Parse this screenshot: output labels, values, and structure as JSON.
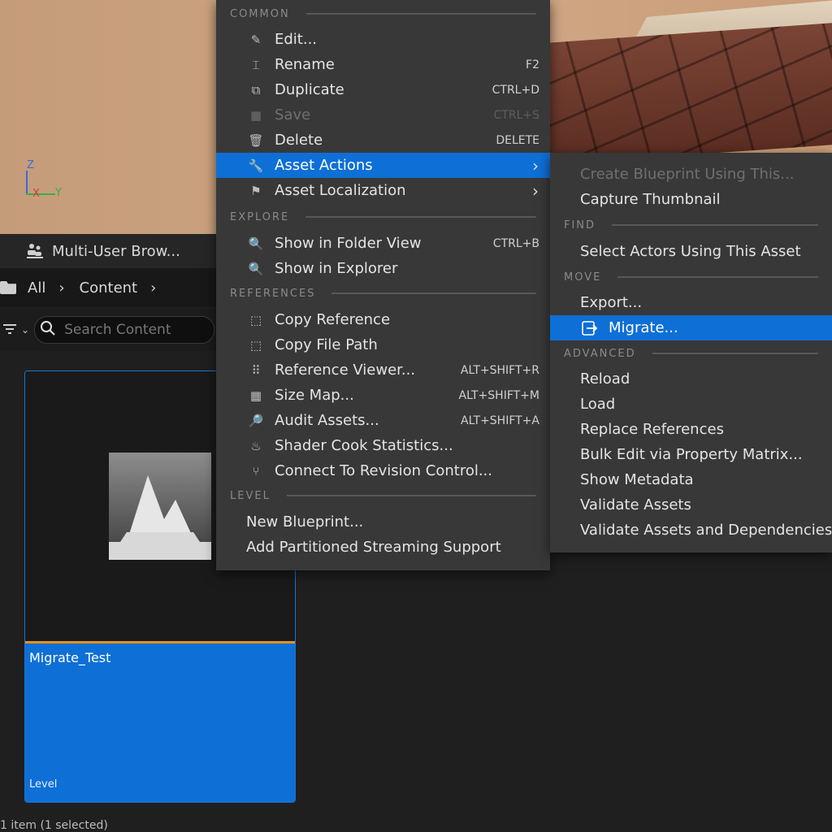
{
  "viewport": {
    "axes": {
      "z": "Z",
      "x": "X",
      "y": "Y"
    }
  },
  "multi_user": {
    "label": "Multi-User Brow..."
  },
  "path": {
    "root": "All",
    "folder": "Content"
  },
  "search": {
    "placeholder": "Search Content"
  },
  "asset": {
    "name": "Migrate_Test",
    "type": "Level"
  },
  "status_text": "1 item (1 selected)",
  "colors": {
    "highlight": "#0e6fd6",
    "menu_bg": "#383838",
    "thumb_border": "#e8901c"
  },
  "main_menu": {
    "common": "COMMON",
    "edit": "Edit...",
    "rename": "Rename",
    "rename_sc": "F2",
    "duplicate": "Duplicate",
    "duplicate_sc": "CTRL+D",
    "save": "Save",
    "save_sc": "CTRL+S",
    "delete": "Delete",
    "delete_sc": "DELETE",
    "asset_actions": "Asset Actions",
    "asset_localization": "Asset Localization",
    "explore": "EXPLORE",
    "show_folder": "Show in Folder View",
    "show_folder_sc": "CTRL+B",
    "show_explorer": "Show in Explorer",
    "references": "REFERENCES",
    "copy_reference": "Copy Reference",
    "copy_file_path": "Copy File Path",
    "reference_viewer": "Reference Viewer...",
    "reference_viewer_sc": "ALT+SHIFT+R",
    "size_map": "Size Map...",
    "size_map_sc": "ALT+SHIFT+M",
    "audit_assets": "Audit Assets...",
    "audit_assets_sc": "ALT+SHIFT+A",
    "shader_cook": "Shader Cook Statistics...",
    "revision_control": "Connect To Revision Control...",
    "level": "LEVEL",
    "new_blueprint": "New Blueprint...",
    "partitioned": "Add Partitioned Streaming Support"
  },
  "sub_menu": {
    "create_blueprint": "Create Blueprint Using This...",
    "capture_thumbnail": "Capture Thumbnail",
    "find": "FIND",
    "select_actors": "Select Actors Using This Asset",
    "move": "MOVE",
    "export": "Export...",
    "migrate": "Migrate...",
    "advanced": "ADVANCED",
    "reload": "Reload",
    "load": "Load",
    "replace_refs": "Replace References",
    "bulk_edit": "Bulk Edit via Property Matrix...",
    "show_metadata": "Show Metadata",
    "validate_assets": "Validate Assets",
    "validate_deps": "Validate Assets and Dependencies"
  }
}
